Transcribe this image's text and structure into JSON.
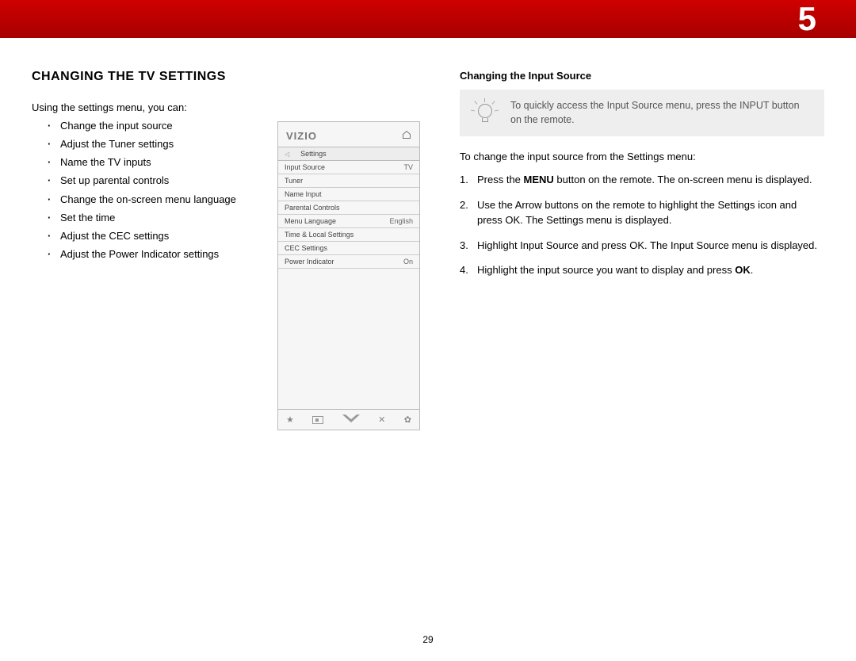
{
  "chapter": "5",
  "page_number": "29",
  "left": {
    "heading": "CHANGING THE TV SETTINGS",
    "intro": "Using the settings menu, you can:",
    "bullets": [
      "Change the input source",
      "Adjust the Tuner settings",
      "Name the TV inputs",
      "Set up parental controls",
      "Change the on-screen menu language",
      "Set the time",
      "Adjust the CEC settings",
      "Adjust the Power Indicator settings"
    ]
  },
  "menu": {
    "brand": "VIZIO",
    "title": "Settings",
    "rows": [
      {
        "label": "Input Source",
        "value": "TV"
      },
      {
        "label": "Tuner",
        "value": ""
      },
      {
        "label": "Name Input",
        "value": ""
      },
      {
        "label": "Parental Controls",
        "value": ""
      },
      {
        "label": "Menu Language",
        "value": "English"
      },
      {
        "label": "Time & Local Settings",
        "value": ""
      },
      {
        "label": "CEC Settings",
        "value": ""
      },
      {
        "label": "Power Indicator",
        "value": "On"
      }
    ],
    "bottom_icons": [
      "star-icon",
      "rect-icon",
      "wide-v-icon",
      "close-icon",
      "gear-icon"
    ]
  },
  "right": {
    "subheading": "Changing the Input Source",
    "tip": "To quickly access the Input Source menu, press the INPUT button on the remote.",
    "lead": "To change the input source from the Settings menu:",
    "steps": [
      {
        "pre": "Press the ",
        "bold": "MENU",
        "post": " button on the remote. The on-screen menu is displayed."
      },
      {
        "pre": "Use the Arrow buttons on the remote to highlight the Settings icon and press OK. The Settings menu is displayed.",
        "bold": "",
        "post": ""
      },
      {
        "pre": "Highlight Input Source and press OK. The Input Source menu is displayed.",
        "bold": "",
        "post": ""
      },
      {
        "pre": "Highlight the input source you want to display and press ",
        "bold": "OK",
        "post": "."
      }
    ]
  }
}
